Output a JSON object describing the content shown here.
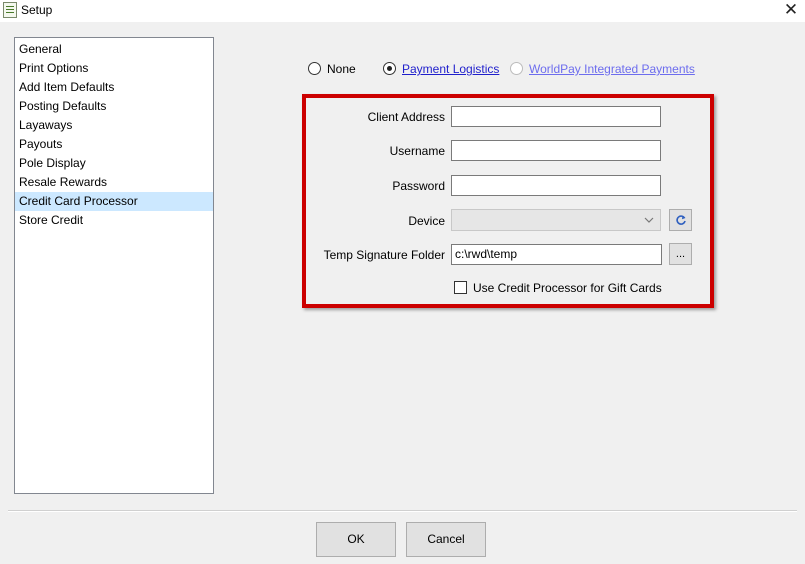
{
  "window": {
    "title": "Setup",
    "close_glyph": "✕"
  },
  "nav": {
    "items": [
      {
        "label": "General"
      },
      {
        "label": "Print Options"
      },
      {
        "label": "Add Item Defaults"
      },
      {
        "label": "Posting Defaults"
      },
      {
        "label": "Layaways"
      },
      {
        "label": "Payouts"
      },
      {
        "label": "Pole Display"
      },
      {
        "label": "Resale Rewards"
      },
      {
        "label": "Credit Card Processor",
        "selected": true
      },
      {
        "label": "Store Credit"
      }
    ]
  },
  "processor_options": {
    "none": "None",
    "payment_logistics": "Payment Logistics",
    "worldpay": "WorldPay Integrated Payments",
    "selected": "Payment Logistics"
  },
  "form": {
    "client_address": {
      "label": "Client Address",
      "value": ""
    },
    "username": {
      "label": "Username",
      "value": ""
    },
    "password": {
      "label": "Password",
      "value": ""
    },
    "device": {
      "label": "Device",
      "value": ""
    },
    "temp_signature_folder": {
      "label": "Temp Signature Folder",
      "value": "c:\\rwd\\temp"
    },
    "browse_button": "...",
    "use_for_gift_cards": {
      "label": "Use Credit Processor for Gift Cards",
      "checked": false
    }
  },
  "buttons": {
    "ok": "OK",
    "cancel": "Cancel"
  },
  "colors": {
    "highlight_border": "#cc0000",
    "selection": "#cce8ff",
    "link": "#1f1fcc"
  },
  "icons": {
    "app": "setup-app-icon",
    "refresh": "refresh-icon",
    "dropdown": "chevron-down-icon",
    "close": "close-icon"
  }
}
